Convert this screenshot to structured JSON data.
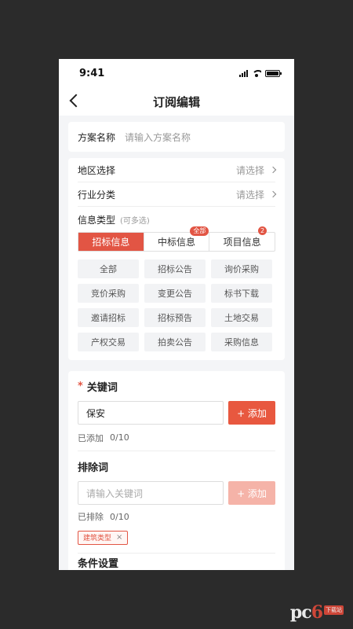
{
  "status": {
    "time": "9:41"
  },
  "nav": {
    "title": "订阅编辑"
  },
  "plan": {
    "label": "方案名称",
    "placeholder": "请输入方案名称"
  },
  "region": {
    "label": "地区选择",
    "value": "请选择"
  },
  "industry": {
    "label": "行业分类",
    "value": "请选择"
  },
  "info_type": {
    "label": "信息类型",
    "hint": "(可多选)",
    "tabs": [
      {
        "label": "招标信息",
        "badge": ""
      },
      {
        "label": "中标信息",
        "badge": "全部"
      },
      {
        "label": "项目信息",
        "badge": "2"
      }
    ],
    "chips": [
      "全部",
      "招标公告",
      "询价采购",
      "竞价采购",
      "变更公告",
      "标书下载",
      "邀请招标",
      "招标预告",
      "土地交易",
      "产权交易",
      "拍卖公告",
      "采购信息"
    ]
  },
  "keywords": {
    "required_mark": "*",
    "title": "关键词",
    "input_value": "保安",
    "add_label": "+ 添加",
    "count_label": "已添加",
    "count_value": "0/10"
  },
  "exclude": {
    "title": "排除词",
    "placeholder": "请输入关键词",
    "add_label": "+ 添加",
    "count_label": "已排除",
    "count_value": "0/10",
    "tags": [
      {
        "label": "建筑类型",
        "remove": "×"
      }
    ]
  },
  "conditions": {
    "title": "条件设置"
  },
  "watermark": {
    "text_a": "pc",
    "text_b": "6",
    "sub": "下载站"
  },
  "colors": {
    "accent": "#e25544",
    "background": "#2b2b2b"
  }
}
